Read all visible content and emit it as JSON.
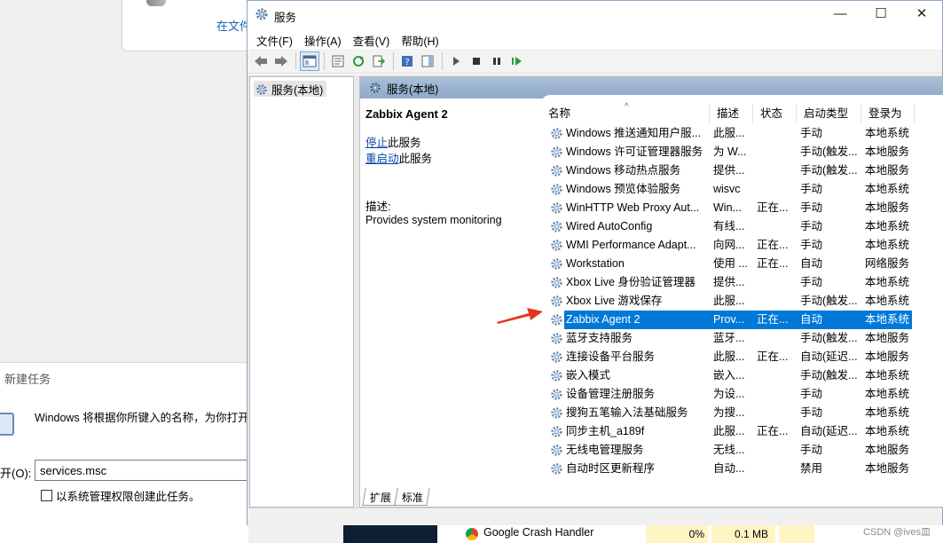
{
  "background": {
    "explorer_link": "在文件",
    "run_dialog": {
      "title": "新建任务",
      "description": "Windows 将根据你所键入的名称，为你打开相应的程序、文件夹、文档或 Internet 资源。",
      "open_label": "开(O):",
      "input_value": "services.msc",
      "admin_checkbox_label": "以系统管理权限创建此任务。"
    }
  },
  "window": {
    "title": "服务",
    "minimize": "—",
    "maximize": "☐",
    "close": "✕",
    "menu": [
      "文件(F)",
      "操作(A)",
      "查看(V)",
      "帮助(H)"
    ]
  },
  "tree": {
    "root": "服务(本地)"
  },
  "pane": {
    "header": "服务(本地)",
    "selected_service": {
      "name": "Zabbix Agent 2",
      "stop_link": "停止",
      "stop_suffix": "此服务",
      "restart_link": "重启动",
      "restart_suffix": "此服务",
      "desc_label": "描述:",
      "desc": "Provides system monitoring"
    },
    "columns": [
      "名称",
      "描述",
      "状态",
      "启动类型",
      "登录为"
    ],
    "rows": [
      {
        "name": "Windows 推送通知用户服...",
        "desc": "此服...",
        "status": "",
        "start": "手动",
        "logon": "本地系统"
      },
      {
        "name": "Windows 许可证管理器服务",
        "desc": "为 W...",
        "status": "",
        "start": "手动(触发...",
        "logon": "本地服务"
      },
      {
        "name": "Windows 移动热点服务",
        "desc": "提供...",
        "status": "",
        "start": "手动(触发...",
        "logon": "本地服务"
      },
      {
        "name": "Windows 预览体验服务",
        "desc": "wisvc",
        "status": "",
        "start": "手动",
        "logon": "本地系统"
      },
      {
        "name": "WinHTTP Web Proxy Aut...",
        "desc": "Win...",
        "status": "正在...",
        "start": "手动",
        "logon": "本地服务"
      },
      {
        "name": "Wired AutoConfig",
        "desc": "有线...",
        "status": "",
        "start": "手动",
        "logon": "本地系统"
      },
      {
        "name": "WMI Performance Adapt...",
        "desc": "向网...",
        "status": "正在...",
        "start": "手动",
        "logon": "本地系统"
      },
      {
        "name": "Workstation",
        "desc": "使用 ...",
        "status": "正在...",
        "start": "自动",
        "logon": "网络服务"
      },
      {
        "name": "Xbox Live 身份验证管理器",
        "desc": "提供...",
        "status": "",
        "start": "手动",
        "logon": "本地系统"
      },
      {
        "name": "Xbox Live 游戏保存",
        "desc": "此服...",
        "status": "",
        "start": "手动(触发...",
        "logon": "本地系统"
      },
      {
        "name": "Zabbix Agent 2",
        "desc": "Prov...",
        "status": "正在...",
        "start": "自动",
        "logon": "本地系统",
        "selected": true
      },
      {
        "name": "蓝牙支持服务",
        "desc": "蓝牙...",
        "status": "",
        "start": "手动(触发...",
        "logon": "本地服务"
      },
      {
        "name": "连接设备平台服务",
        "desc": "此服...",
        "status": "正在...",
        "start": "自动(延迟...",
        "logon": "本地服务"
      },
      {
        "name": "嵌入模式",
        "desc": "嵌入...",
        "status": "",
        "start": "手动(触发...",
        "logon": "本地系统"
      },
      {
        "name": "设备管理注册服务",
        "desc": "为设...",
        "status": "",
        "start": "手动",
        "logon": "本地系统"
      },
      {
        "name": "搜狗五笔输入法基础服务",
        "desc": "为搜...",
        "status": "",
        "start": "手动",
        "logon": "本地系统"
      },
      {
        "name": "同步主机_a189f",
        "desc": "此服...",
        "status": "正在...",
        "start": "自动(延迟...",
        "logon": "本地系统"
      },
      {
        "name": "无线电管理服务",
        "desc": "无线...",
        "status": "",
        "start": "手动",
        "logon": "本地服务"
      },
      {
        "name": "自动时区更新程序",
        "desc": "自动...",
        "status": "",
        "start": "禁用",
        "logon": "本地服务"
      }
    ],
    "tabs": [
      "扩展",
      "标准"
    ]
  },
  "taskmanager": {
    "process": "Google Crash Handler",
    "cpu": "0%",
    "memory": "0.1 MB"
  },
  "watermark": "CSDN @ives皿",
  "colors": {
    "selection": "#0078d7",
    "arrow": "#e8321e",
    "header": "#9db5d1"
  }
}
